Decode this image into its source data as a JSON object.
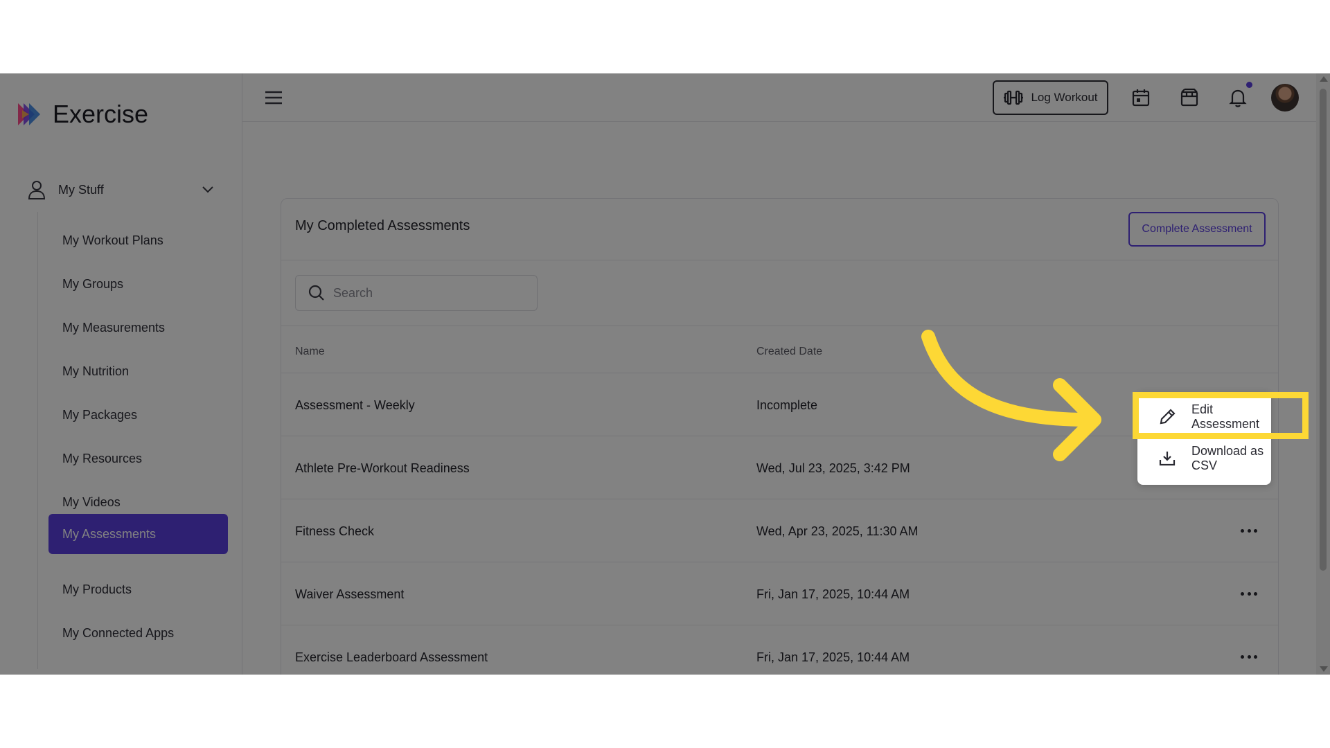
{
  "app": {
    "name": "Exercise"
  },
  "sidebar": {
    "section_label": "My Stuff",
    "items": [
      {
        "label": "My Workout Plans"
      },
      {
        "label": "My Groups"
      },
      {
        "label": "My Measurements"
      },
      {
        "label": "My Nutrition"
      },
      {
        "label": "My Packages"
      },
      {
        "label": "My Resources"
      },
      {
        "label": "My Videos"
      },
      {
        "label": "My Assessments",
        "active": true
      },
      {
        "label": "My Products"
      },
      {
        "label": "My Connected Apps"
      }
    ]
  },
  "header": {
    "log_workout_label": "Log Workout",
    "icons": [
      "hamburger-menu-icon",
      "dumbbell-icon",
      "calendar-icon",
      "package-icon",
      "bell-icon"
    ]
  },
  "card": {
    "title": "My Completed Assessments",
    "complete_button_label": "Complete Assessment",
    "search_placeholder": "Search",
    "columns": [
      "Name",
      "Created Date"
    ],
    "rows": [
      {
        "name": "Assessment - Weekly",
        "created": "Incomplete"
      },
      {
        "name": "Athlete Pre-Workout Readiness",
        "created": "Wed, Jul 23, 2025, 3:42 PM"
      },
      {
        "name": "Fitness Check",
        "created": "Wed, Apr 23, 2025, 11:30 AM"
      },
      {
        "name": "Waiver Assessment",
        "created": "Fri, Jan 17, 2025, 10:44 AM"
      },
      {
        "name": "Exercise Leaderboard Assessment",
        "created": "Fri, Jan 17, 2025, 10:44 AM"
      }
    ]
  },
  "dropdown": {
    "items": [
      {
        "label": "Edit Assessment",
        "icon": "pencil-icon"
      },
      {
        "label": "Download as CSV",
        "icon": "download-icon"
      }
    ]
  },
  "colors": {
    "accent": "#5b3fe0",
    "highlight": "#fdd835"
  }
}
